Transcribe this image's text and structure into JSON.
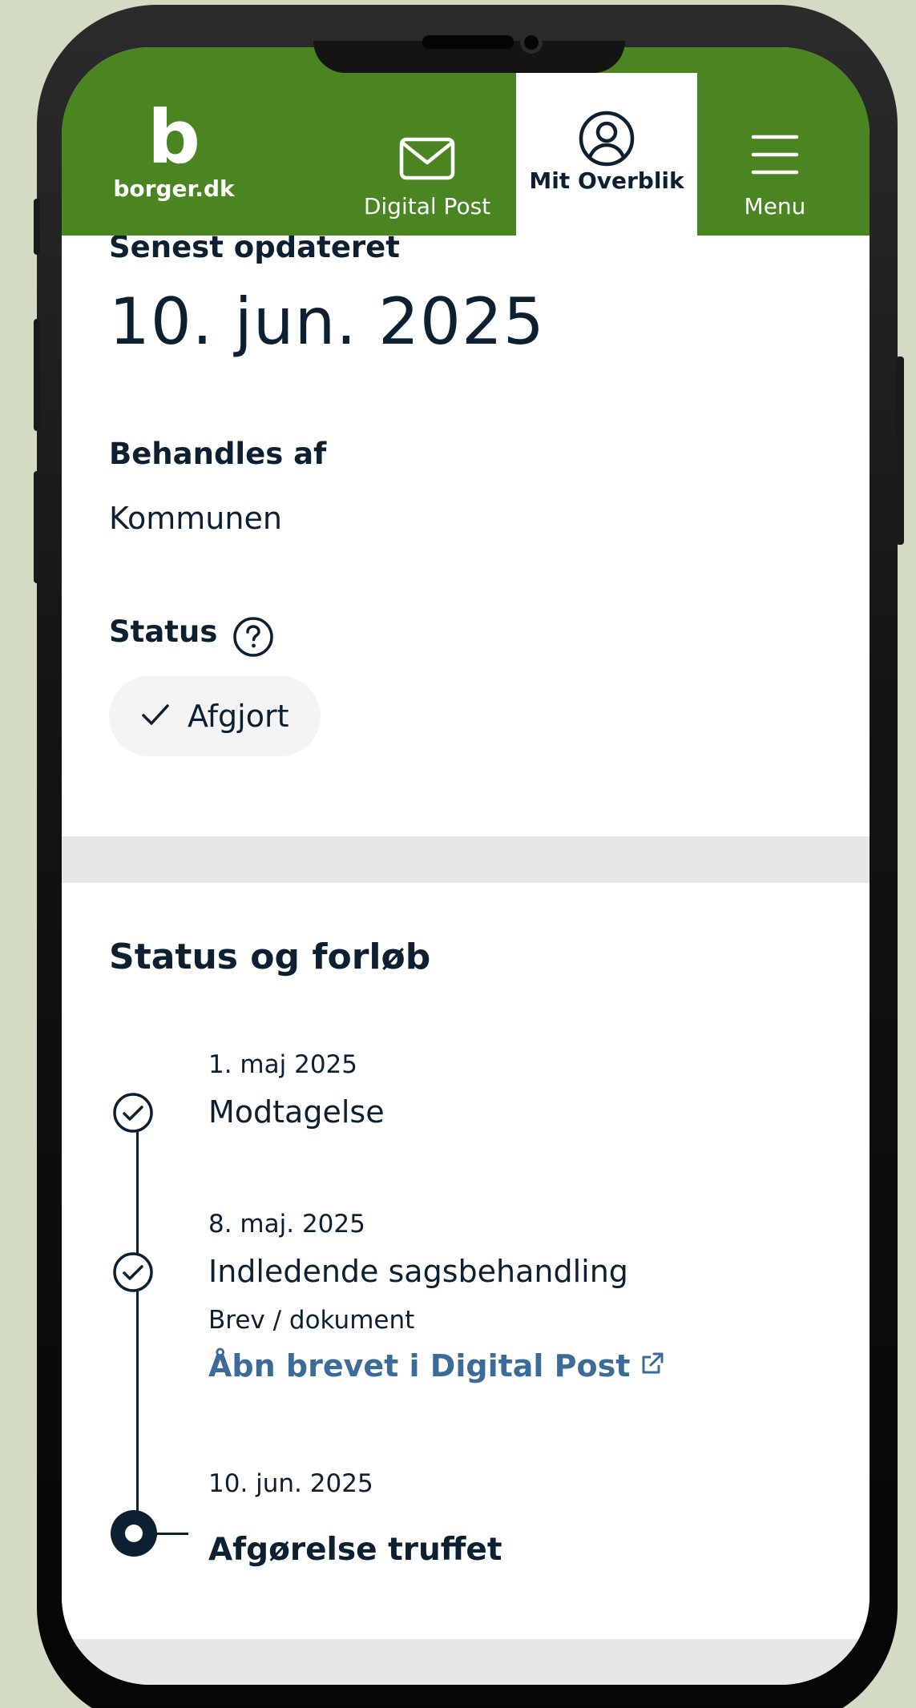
{
  "header": {
    "logo_letter": "b",
    "logo_text": "borger.dk",
    "nav": [
      {
        "label": "Digital Post",
        "icon": "envelope-icon"
      },
      {
        "label": "Mit Overblik",
        "icon": "user-circle-icon",
        "active": true
      },
      {
        "label": "Menu",
        "icon": "hamburger-menu-icon"
      }
    ]
  },
  "details": {
    "updated_label": "Senest opdateret",
    "updated_date": "10. jun. 2025",
    "handled_by_label": "Behandles af",
    "handled_by_value": "Kommunen",
    "status_label": "Status",
    "status_value": "Afgjort"
  },
  "progress": {
    "title": "Status og forløb",
    "steps": [
      {
        "date": "1. maj 2025",
        "title": "Modtagelse",
        "state": "done"
      },
      {
        "date": "8. maj. 2025",
        "title": "Indledende sagsbehandling",
        "state": "done",
        "document_label": "Brev / dokument",
        "link_label": "Åbn brevet i Digital Post"
      },
      {
        "date": "10. jun. 2025",
        "title": "Afgørelse truffet",
        "state": "current"
      }
    ]
  },
  "colors": {
    "brand_green": "#4a8521",
    "text_dark": "#0c2032",
    "link_blue": "#3c6b9a",
    "background": "#d3dbc4"
  }
}
